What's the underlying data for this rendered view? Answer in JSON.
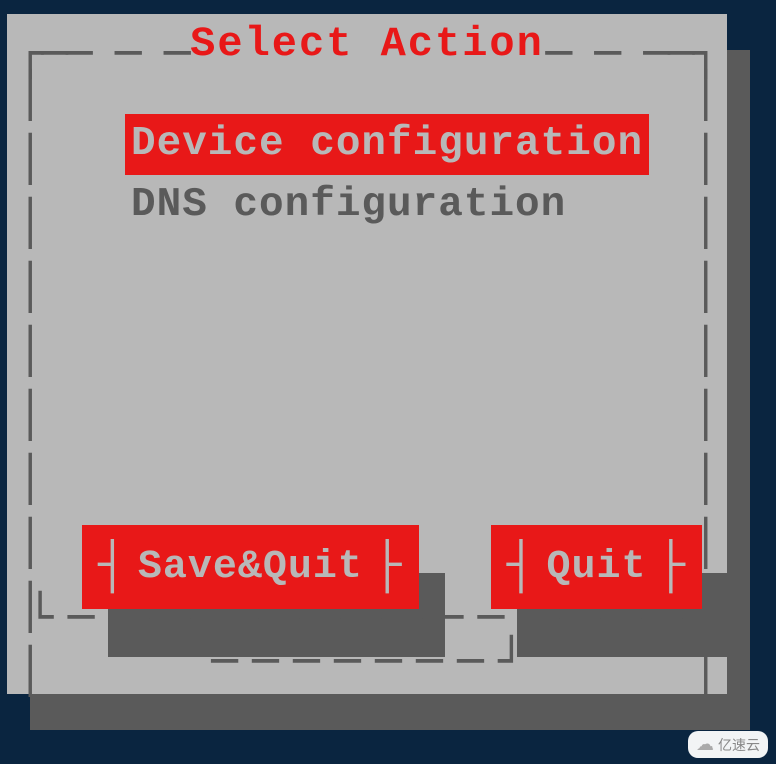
{
  "dialog": {
    "title": "Select Action",
    "menu_items": [
      {
        "label": "Device configuration",
        "selected": true
      },
      {
        "label": "DNS configuration",
        "selected": false
      }
    ],
    "buttons": {
      "save_quit": "Save&Quit",
      "quit": "Quit"
    }
  },
  "watermark": {
    "text": "亿速云"
  }
}
